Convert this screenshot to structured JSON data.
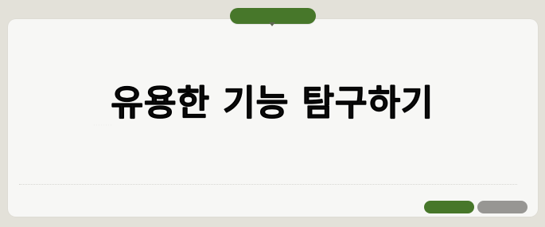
{
  "page": {
    "title": "유용한 기능 탐구하기"
  },
  "colors": {
    "background": "#e3e1d9",
    "card": "#f7f7f5",
    "accent_green": "#47772a",
    "accent_gray": "#979693",
    "text": "#0d0d0d"
  }
}
